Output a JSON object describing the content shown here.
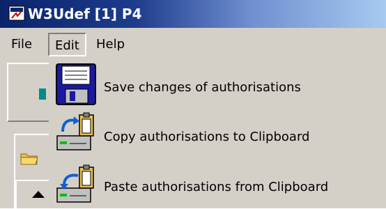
{
  "window": {
    "title": "W3Udef [1] P4"
  },
  "menubar": {
    "items": [
      {
        "label": "File"
      },
      {
        "label": "Edit"
      },
      {
        "label": "Help"
      }
    ]
  },
  "edit_menu": {
    "items": [
      {
        "label": "Save changes of authorisations",
        "icon": "floppy-disk-icon"
      },
      {
        "label": "Copy authorisations to Clipboard",
        "icon": "copy-to-clipboard-icon"
      },
      {
        "label": "Paste authorisations from Clipboard",
        "icon": "paste-from-clipboard-icon"
      }
    ]
  },
  "colors": {
    "titlebar_start": "#0a246a",
    "titlebar_end": "#a6caf0",
    "face": "#d4d0c8"
  }
}
